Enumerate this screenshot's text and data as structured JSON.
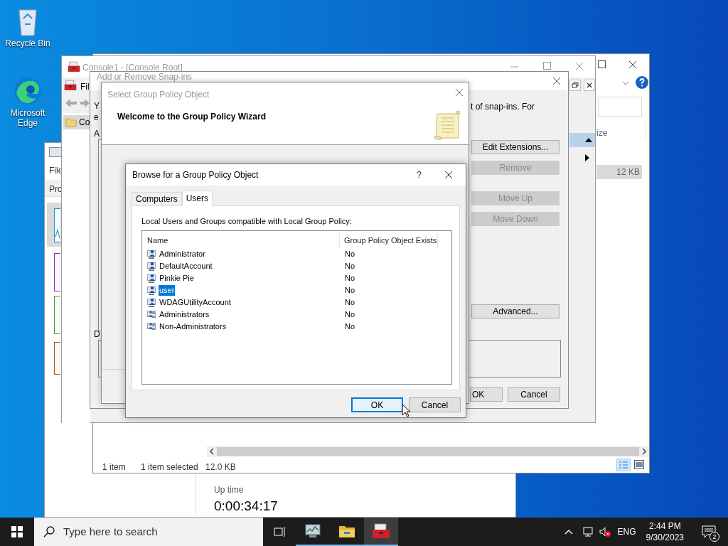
{
  "desktop_icons": [
    {
      "label": "Recycle Bin",
      "kind": "bin"
    },
    {
      "label": "Microsoft Edge",
      "kind": "edge"
    }
  ],
  "task_manager": {
    "menu": "File",
    "tab": "Pro",
    "uptime_label": "Up time",
    "uptime": "0:00:34:17"
  },
  "explorer": {
    "column_header": "ize",
    "row_size": "12 KB",
    "status_count": "1 item",
    "status_selected": "1 item selected",
    "status_size": "12.0 KB"
  },
  "mmc": {
    "title": "Console1 - [Console Root]",
    "menu": "Fil",
    "tree_item": "Co"
  },
  "snapins": {
    "title": "Add or Remove Snap-ins",
    "intro_left": [
      "Y",
      "e"
    ],
    "intro_right": "t of snap-ins. For",
    "available_label": "A",
    "description_label": "D",
    "buttons": [
      {
        "label": "Edit Extensions...",
        "disabled": false
      },
      {
        "label": "Remove",
        "disabled": true
      },
      {
        "label": "Move Up",
        "disabled": true
      },
      {
        "label": "Move Down",
        "disabled": true
      },
      {
        "label": "Advanced...",
        "disabled": false
      }
    ],
    "ok": "OK",
    "cancel": "Cancel"
  },
  "wizard": {
    "title": "Select Group Policy Object",
    "heading": "Welcome to the Group Policy Wizard"
  },
  "browse": {
    "title": "Browse for a Group Policy Object",
    "help": "?",
    "tabs": [
      {
        "label": "Computers",
        "selected": false
      },
      {
        "label": "Users",
        "selected": true
      }
    ],
    "caption": "Local Users and Groups compatible with Local Group Policy:",
    "columns": [
      "Name",
      "Group Policy Object Exists"
    ],
    "rows": [
      {
        "name": "Administrator",
        "exists": "No",
        "kind": "user",
        "selected": false
      },
      {
        "name": "DefaultAccount",
        "exists": "No",
        "kind": "user",
        "selected": false
      },
      {
        "name": "Pinkie Pie",
        "exists": "No",
        "kind": "user",
        "selected": false
      },
      {
        "name": "user",
        "exists": "No",
        "kind": "user",
        "selected": true
      },
      {
        "name": "WDAGUtilityAccount",
        "exists": "No",
        "kind": "user",
        "selected": false
      },
      {
        "name": "Administrators",
        "exists": "No",
        "kind": "group",
        "selected": false
      },
      {
        "name": "Non-Administrators",
        "exists": "No",
        "kind": "group",
        "selected": false
      }
    ],
    "ok": "OK",
    "cancel": "Cancel"
  },
  "taskbar": {
    "search_placeholder": "Type here to search",
    "apps": [
      {
        "kind": "task-manager",
        "selected": false
      },
      {
        "kind": "explorer",
        "selected": false
      },
      {
        "kind": "mmc",
        "selected": true
      }
    ],
    "language": "ENG",
    "time": "2:44 PM",
    "date": "9/30/2023",
    "notifications": "2"
  }
}
